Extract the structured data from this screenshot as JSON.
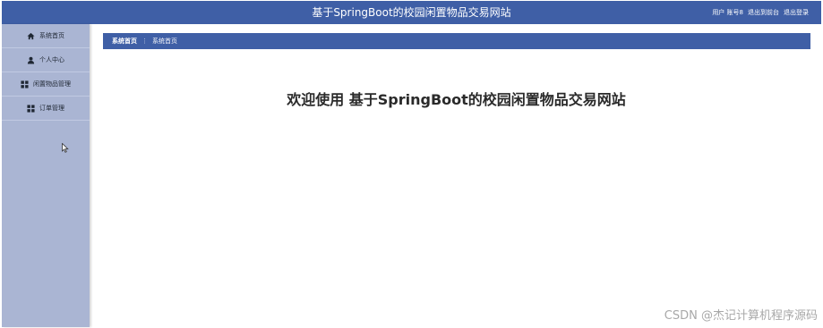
{
  "header": {
    "title": "基于SpringBoot的校园闲置物品交易网站",
    "user_label": "用户 账号8",
    "back_to_front": "退出到前台",
    "logout": "退出登录"
  },
  "sidebar": {
    "items": [
      {
        "label": "系统首页",
        "icon": "home-icon"
      },
      {
        "label": "个人中心",
        "icon": "user-icon"
      },
      {
        "label": "闲置物品管理",
        "icon": "grid-icon"
      },
      {
        "label": "订单管理",
        "icon": "grid-icon"
      }
    ]
  },
  "breadcrumb": {
    "home": "系统首页",
    "separator": "⋮",
    "current": "系统首页"
  },
  "main": {
    "welcome": "欢迎使用 基于SpringBoot的校园闲置物品交易网站"
  },
  "watermark": "CSDN @杰记计算机程序源码",
  "colors": {
    "header_bg": "#3f5fa6",
    "sidebar_bg": "#aab5d3",
    "text_dark": "#2a2a2a"
  }
}
